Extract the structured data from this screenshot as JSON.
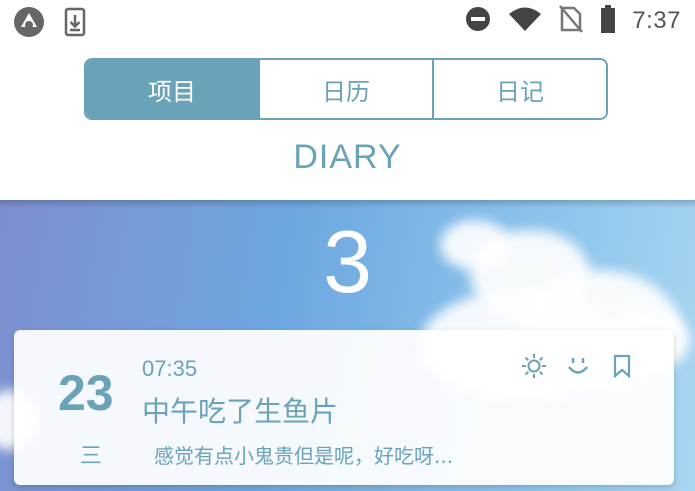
{
  "status_bar": {
    "time": "7:37",
    "icons": [
      "android-icon",
      "download-icon",
      "do-not-disturb-icon",
      "wifi-icon",
      "no-sim-icon",
      "battery-icon"
    ]
  },
  "tabs": [
    {
      "label": "项目",
      "active": true
    },
    {
      "label": "日历",
      "active": false
    },
    {
      "label": "日记",
      "active": false
    }
  ],
  "header": {
    "title": "DIARY"
  },
  "month": {
    "number": "3"
  },
  "entry": {
    "day": "23",
    "weekday": "三",
    "time": "07:35",
    "title": "中午吃了生鱼片",
    "excerpt": "感觉有点小鬼贵但是呢，好吃呀...",
    "weather_icon": "sun-icon",
    "mood_icon": "smile-icon",
    "bookmark_icon": "bookmark-icon"
  },
  "colors": {
    "accent": "#6aa3b8",
    "sky_start": "#7d8ed0",
    "sky_end": "#a9d6f1"
  }
}
